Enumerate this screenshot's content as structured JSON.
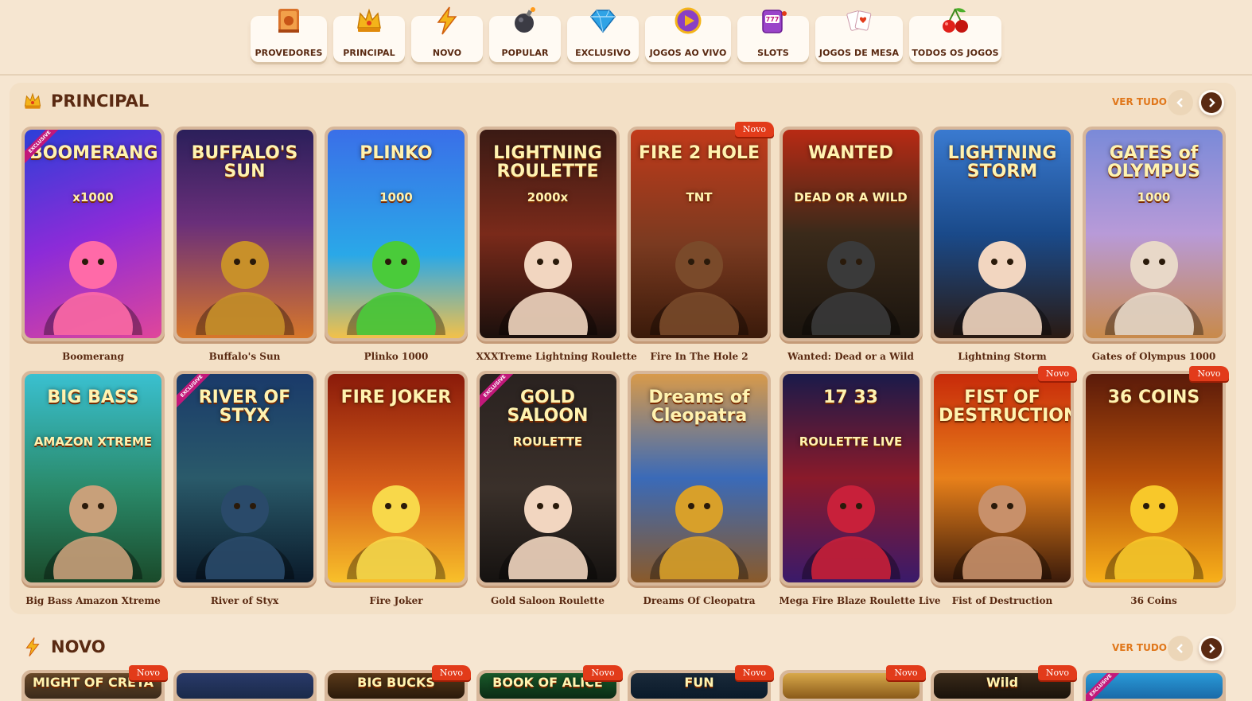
{
  "tabs": [
    {
      "label": "PROVEDORES",
      "icon": "book-icon"
    },
    {
      "label": "PRINCIPAL",
      "icon": "crown-icon"
    },
    {
      "label": "NOVO",
      "icon": "lightning-icon"
    },
    {
      "label": "POPULAR",
      "icon": "bomb-icon"
    },
    {
      "label": "EXCLUSIVO",
      "icon": "diamond-icon"
    },
    {
      "label": "JOGOS AO VIVO",
      "icon": "play-icon"
    },
    {
      "label": "SLOTS",
      "icon": "slot-machine-icon"
    },
    {
      "label": "JOGOS DE MESA",
      "icon": "cards-icon"
    },
    {
      "label": "TODOS OS JOGOS",
      "icon": "cherries-icon"
    }
  ],
  "principal": {
    "title": "PRINCIPAL",
    "icon": "crown-icon",
    "see_all": "VER TUDO",
    "games": [
      {
        "title": "Boomerang",
        "logo": "BOOMERANG",
        "sub": "x1000",
        "badge": "",
        "excl": "EXCLUSIVE"
      },
      {
        "title": "Buffalo's Sun",
        "logo": "BUFFALO'S SUN",
        "badge": "",
        "excl": ""
      },
      {
        "title": "Plinko 1000",
        "logo": "PLINKO",
        "sub": "1000",
        "badge": "",
        "excl": ""
      },
      {
        "title": "XXXTreme Lightning Roulette",
        "logo": "LIGHTNING ROULETTE",
        "sub": "2000x",
        "badge": "",
        "excl": ""
      },
      {
        "title": "Fire In The Hole 2",
        "logo": "FIRE 2 HOLE",
        "sub": "TNT",
        "badge": "Novo",
        "excl": ""
      },
      {
        "title": "Wanted: Dead or a Wild",
        "logo": "WANTED",
        "sub": "DEAD OR A WILD",
        "badge": "",
        "excl": ""
      },
      {
        "title": "Lightning Storm",
        "logo": "LIGHTNING STORM",
        "badge": "",
        "excl": ""
      },
      {
        "title": "Gates of Olympus 1000",
        "logo": "GATES of OLYMPUS",
        "sub": "1000",
        "badge": "",
        "excl": ""
      },
      {
        "title": "Big Bass Amazon Xtreme",
        "logo": "BIG BASS",
        "sub": "AMAZON XTREME",
        "badge": "",
        "excl": ""
      },
      {
        "title": "River of Styx",
        "logo": "RIVER OF STYX",
        "badge": "",
        "excl": "EXCLUSIVE"
      },
      {
        "title": "Fire Joker",
        "logo": "FIRE JOKER",
        "badge": "",
        "excl": ""
      },
      {
        "title": "Gold Saloon Roulette",
        "logo": "GOLD SALOON",
        "sub": "ROULETTE",
        "badge": "",
        "excl": "EXCLUSIVE"
      },
      {
        "title": "Dreams Of Cleopatra",
        "logo": "Dreams of Cleopatra",
        "badge": "",
        "excl": ""
      },
      {
        "title": "Mega Fire Blaze Roulette Live",
        "logo": "17 33",
        "sub": "ROULETTE LIVE",
        "badge": "",
        "excl": ""
      },
      {
        "title": "Fist of Destruction",
        "logo": "FIST OF DESTRUCTION",
        "badge": "Novo",
        "excl": ""
      },
      {
        "title": "36 Coins",
        "logo": "36 COINS",
        "badge": "Novo",
        "excl": ""
      }
    ]
  },
  "novo": {
    "title": "NOVO",
    "icon": "lightning-icon",
    "see_all": "VER TUDO",
    "games": [
      {
        "logo": "MIGHT OF CRETA",
        "badge": "Novo",
        "excl": ""
      },
      {
        "logo": "",
        "badge": "",
        "excl": ""
      },
      {
        "logo": "BIG BUCKS",
        "badge": "Novo",
        "excl": ""
      },
      {
        "logo": "BOOK OF ALICE",
        "badge": "Novo",
        "excl": ""
      },
      {
        "logo": "FUN",
        "badge": "Novo",
        "excl": ""
      },
      {
        "logo": "",
        "badge": "Novo",
        "excl": ""
      },
      {
        "logo": "Wild",
        "badge": "Novo",
        "excl": ""
      },
      {
        "logo": "",
        "badge": "",
        "excl": "EXCLUSIVE"
      }
    ]
  },
  "colors": {
    "background": "#f6e6d1",
    "panel": "#f3e0c6",
    "accent": "#e0771b",
    "text": "#5a2a12",
    "badge": "#e23b1a"
  }
}
